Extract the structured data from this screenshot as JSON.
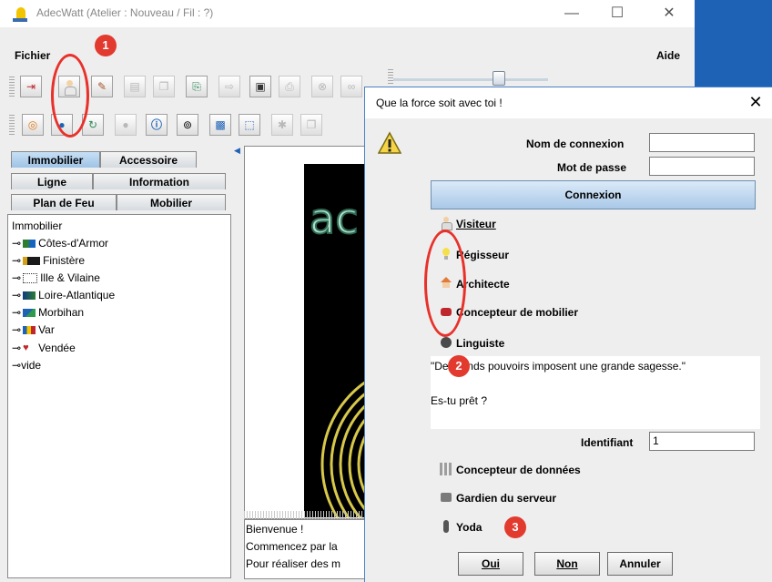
{
  "main_window": {
    "title": "AdecWatt (Atelier : Nouveau / Fil : ?)",
    "menu": {
      "file": "Fichier",
      "help": "Aide"
    },
    "window_controls": {
      "minimize": "—",
      "maximize": "☐",
      "close": "✕"
    }
  },
  "left_panel": {
    "tabs_row1": [
      "Immobilier",
      "Accessoire"
    ],
    "tabs_row2": [
      "Ligne",
      "Information"
    ],
    "tabs_row3": [
      "Plan de Feu",
      "Mobilier"
    ],
    "selected_tab": "Immobilier",
    "tree": {
      "root": "Immobilier",
      "items": [
        "Côtes-d'Armor",
        "Finistère",
        "Ille & Vilaine",
        "Loire-Atlantique",
        "Morbihan",
        "Var",
        "Vendée",
        "vide"
      ]
    }
  },
  "log": {
    "lines": [
      "Bienvenue !",
      "Commencez par la",
      "Pour réaliser des m"
    ]
  },
  "dialog": {
    "title": "Que la force soit avec toi !",
    "close_icon": "✕",
    "login_label": "Nom de connexion",
    "login_value": "",
    "password_label": "Mot de passe",
    "password_value": "",
    "connect_button": "Connexion",
    "roles": [
      "Visiteur",
      "Régisseur",
      "Architecte",
      "Concepteur de mobilier",
      "Linguiste"
    ],
    "message_line1": "\"De grands pouvoirs imposent une grande sagesse.\"",
    "message_line2": "Es-tu prêt ?",
    "id_label": "Identifiant",
    "id_value": "1",
    "extra_roles": [
      "Concepteur de données",
      "Gardien du serveur",
      "Yoda"
    ],
    "buttons": {
      "yes": "Oui",
      "no": "Non",
      "cancel": "Annuler"
    }
  },
  "annotations": [
    "1",
    "2",
    "3"
  ],
  "colors": {
    "accent_blue": "#1e62b6",
    "annotation_red": "#e23a2e",
    "connect_button": "#b8d4ee"
  }
}
